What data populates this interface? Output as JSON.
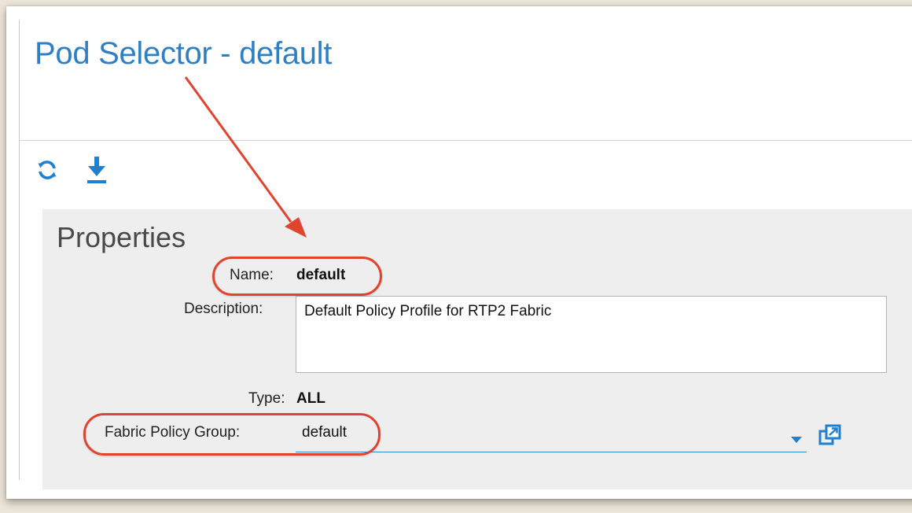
{
  "page": {
    "title": "Pod Selector - default"
  },
  "toolbar": {
    "refresh_icon": "refresh-icon",
    "download_icon": "download-icon"
  },
  "properties": {
    "heading": "Properties",
    "name_label": "Name:",
    "name_value": "default",
    "description_label": "Description:",
    "description_value": "Default Policy Profile for RTP2 Fabric",
    "type_label": "Type:",
    "type_value": "ALL",
    "fabric_policy_group_label": "Fabric Policy Group:",
    "fabric_policy_group_value": "default"
  },
  "colors": {
    "title": "#2f7fc4",
    "accent": "#1f7fd0",
    "annotation": "#e1442e"
  }
}
